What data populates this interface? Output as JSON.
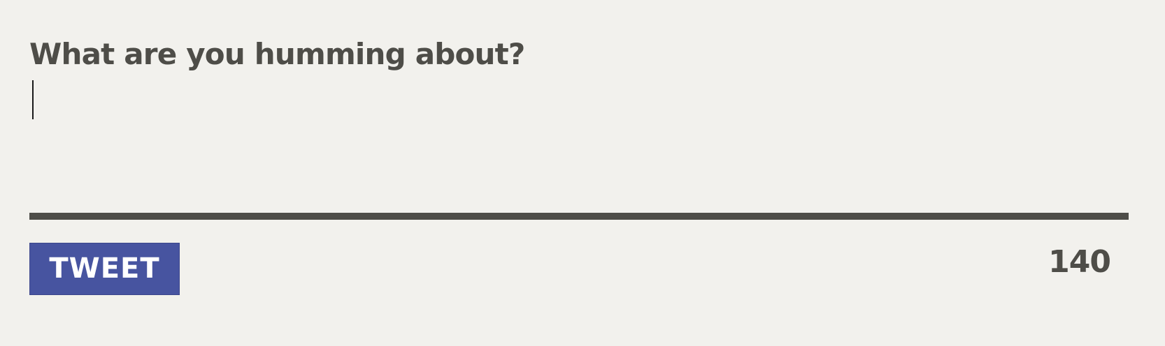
{
  "composer": {
    "prompt": "What are you humming about?",
    "input_value": "",
    "tweet_label": "TWEET",
    "char_count": "140"
  },
  "colors": {
    "background": "#f2f1ed",
    "text": "#4e4d48",
    "button": "#4754a0",
    "button_text": "#ffffff"
  }
}
